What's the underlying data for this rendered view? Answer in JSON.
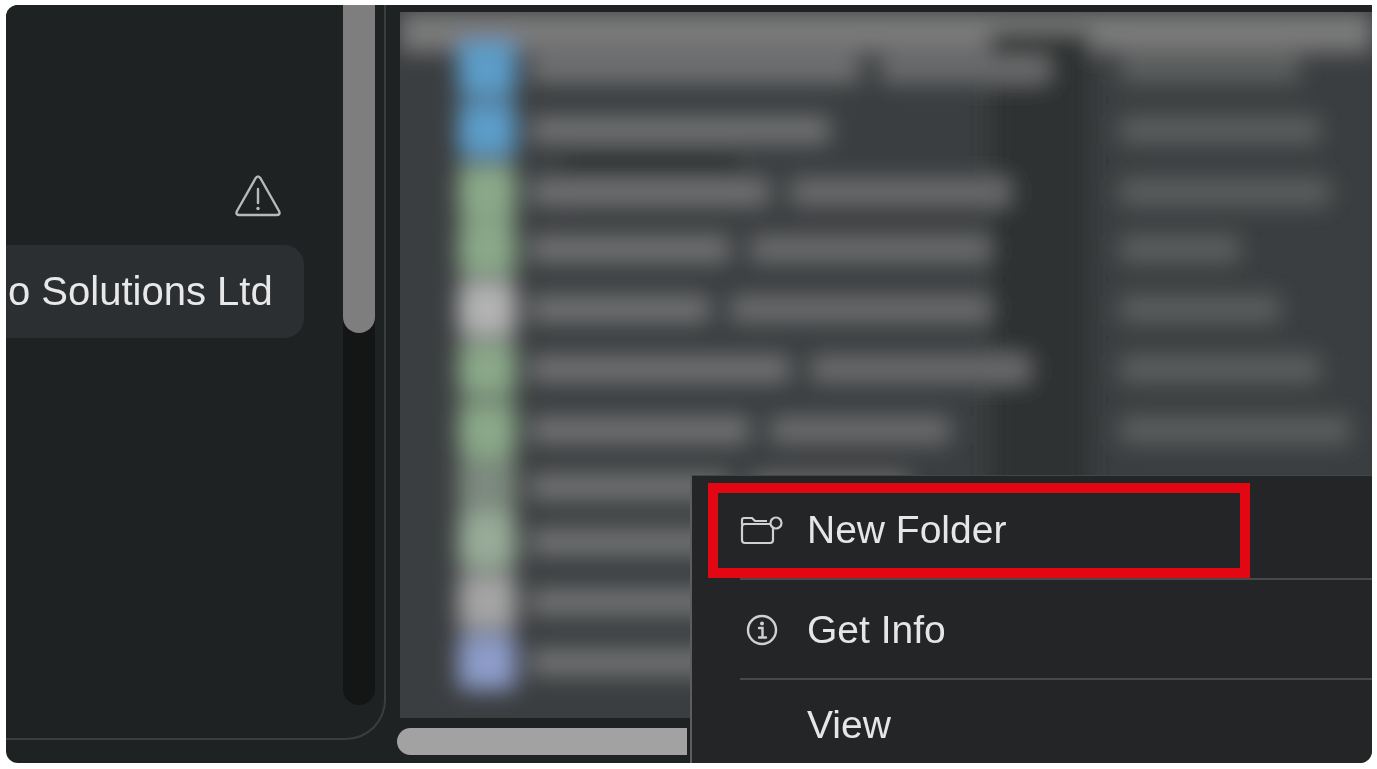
{
  "sidebar": {
    "warning": true,
    "items": [
      {
        "label": "o Solutions Ltd",
        "selected": true
      }
    ]
  },
  "file_list": {
    "obscured": true
  },
  "context_menu": {
    "items": [
      {
        "kind": "create",
        "label": "New Folder",
        "annotated": true
      },
      {
        "kind": "separator"
      },
      {
        "kind": "info",
        "label": "Get Info",
        "annotated": false
      },
      {
        "kind": "separator"
      },
      {
        "kind": "plain",
        "label": "View",
        "annotated": false
      }
    ]
  }
}
